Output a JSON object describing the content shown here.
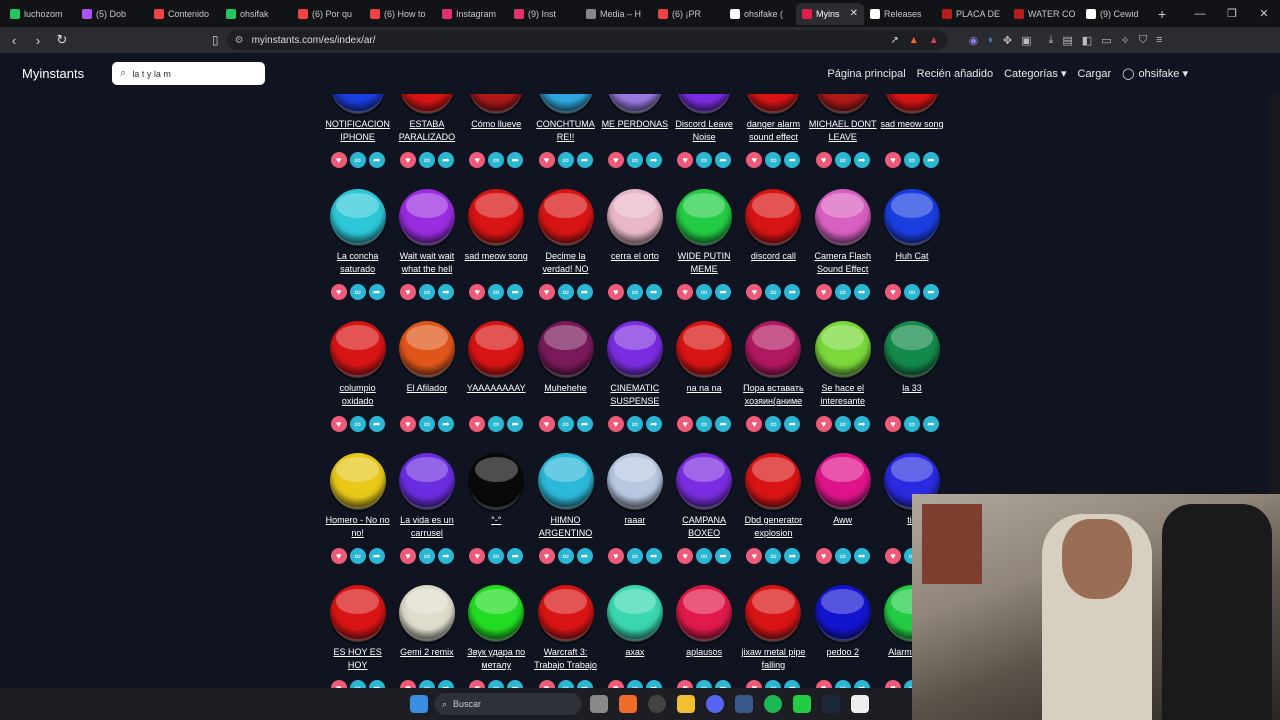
{
  "browser": {
    "tabs": [
      {
        "label": "luchozom",
        "color": "#22c55e"
      },
      {
        "label": "(5) Dob",
        "color": "#a855f7"
      },
      {
        "label": "Contenido",
        "color": "#ef4444"
      },
      {
        "label": "ohsifak",
        "color": "#22c55e"
      },
      {
        "label": "(6) Por qu",
        "color": "#ef4444"
      },
      {
        "label": "(6) How to",
        "color": "#ef4444"
      },
      {
        "label": "Instagram",
        "color": "#e1306c"
      },
      {
        "label": "(9) Inst",
        "color": "#e1306c"
      },
      {
        "label": "Media – H",
        "color": "#888888"
      },
      {
        "label": "(6) ¡PR",
        "color": "#ef4444"
      },
      {
        "label": "ohsifake (",
        "color": "#ffffff"
      },
      {
        "label": "Myins",
        "color": "#e11d48",
        "active": true
      },
      {
        "label": "Releases",
        "color": "#ffffff"
      },
      {
        "label": "PLACA DE",
        "color": "#b91c1c"
      },
      {
        "label": "WATER CO",
        "color": "#b91c1c"
      },
      {
        "label": "(9) Cewid",
        "color": "#ffffff"
      }
    ],
    "url": "myinstants.com/es/index/ar/",
    "new_tab_symbol": "+",
    "close_symbol": "✕"
  },
  "site": {
    "brand": "Myinstants",
    "search_value": "la t y la m",
    "nav": [
      "Página principal",
      "Recién añadido",
      "Categorías ▾",
      "Cargar"
    ],
    "user": "ohsifake ▾"
  },
  "rows": [
    [
      {
        "label": "NOTIFICACION IPHONE",
        "color": "#1a3ee0"
      },
      {
        "label": "ESTABA PARALIZADO",
        "color": "#d81414"
      },
      {
        "label": "Cómo llueve",
        "color": "#b01818"
      },
      {
        "label": "CONCHTUMA RE!!",
        "color": "#2fa8e0"
      },
      {
        "label": "ME PERDONAS",
        "color": "#9a7ae0"
      },
      {
        "label": "Discord Leave Noise",
        "color": "#7a2de0"
      },
      {
        "label": "danger alarm sound effect",
        "color": "#d81414"
      },
      {
        "label": "MICHAEL DONT LEAVE",
        "color": "#b01818"
      },
      {
        "label": "sad meow song",
        "color": "#d81414"
      }
    ],
    [
      {
        "label": "La concha saturado",
        "color": "#2cc8d8"
      },
      {
        "label": "Wait wait wait what the hell",
        "color": "#9a2de0"
      },
      {
        "label": "sad meow song",
        "color": "#d81414"
      },
      {
        "label": "Decime la verdad! NO",
        "color": "#d81414"
      },
      {
        "label": "cerra el orto",
        "color": "#e8b8c8"
      },
      {
        "label": "WIDE PUTIN MEME",
        "color": "#22cc44"
      },
      {
        "label": "discord call",
        "color": "#d81414"
      },
      {
        "label": "Camera Flash Sound Effect",
        "color": "#d860c0"
      },
      {
        "label": "Huh Cat",
        "color": "#1a3ee0"
      }
    ],
    [
      {
        "label": "columpio oxidado",
        "color": "#d81414"
      },
      {
        "label": "El Afilador",
        "color": "#e0561a"
      },
      {
        "label": "YAAAAAAAAY",
        "color": "#d81414"
      },
      {
        "label": "Muhehehe",
        "color": "#7a1a5a"
      },
      {
        "label": "CINEMATIC SUSPENSE",
        "color": "#7a2de0"
      },
      {
        "label": "na na na",
        "color": "#d81414"
      },
      {
        "label": "Пора вставать хозяин(аниме",
        "color": "#b01860"
      },
      {
        "label": "Se hace el interesante",
        "color": "#7ad83a"
      },
      {
        "label": "la 33",
        "color": "#148a4a"
      }
    ],
    [
      {
        "label": "Homero - No no no!",
        "color": "#e8c818"
      },
      {
        "label": "La vida es un carrusel",
        "color": "#6a2de0"
      },
      {
        "label": "°-°",
        "color": "#0a0a0a"
      },
      {
        "label": "HIMNO ARGENTINO",
        "color": "#2cb8d8"
      },
      {
        "label": "raaar",
        "color": "#b8c8e0"
      },
      {
        "label": "CAMPANA BOXEO",
        "color": "#7a2de0"
      },
      {
        "label": "Dbd generator explosion",
        "color": "#d81414"
      },
      {
        "label": "Aww",
        "color": "#e0148a"
      },
      {
        "label": "tio",
        "color": "#2a2ae0"
      }
    ],
    [
      {
        "label": "ES HOY ES HOY",
        "color": "#d81414"
      },
      {
        "label": "Gemi 2 remix",
        "color": "#e0dccc"
      },
      {
        "label": "Звук удара по металу",
        "color": "#22dd22"
      },
      {
        "label": "Warcraft 3: Trabajo Trabajo",
        "color": "#d81414"
      },
      {
        "label": "axax",
        "color": "#3ad8b0"
      },
      {
        "label": "aplausos",
        "color": "#e01a4a"
      },
      {
        "label": "jixaw metal pipe falling",
        "color": "#d81414"
      },
      {
        "label": "pedoo 2",
        "color": "#1414d0"
      },
      {
        "label": "Alarm Auror",
        "color": "#22cc44"
      }
    ]
  ],
  "taskbar": {
    "search_label": "Buscar"
  }
}
